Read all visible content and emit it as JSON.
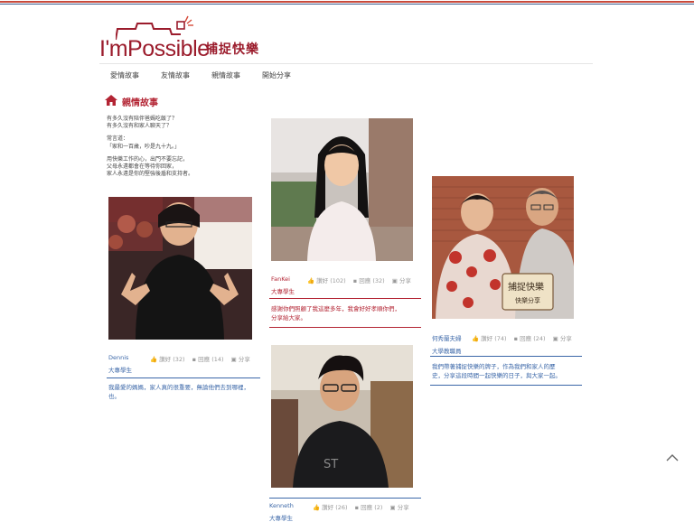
{
  "brand": {
    "logo_text": "I'mPossible",
    "logo_cn": "捕捉快樂",
    "brand_color": "#9b1c2c"
  },
  "nav": {
    "items": [
      "愛情故事",
      "友情故事",
      "親情故事",
      "開始分享"
    ]
  },
  "section": {
    "title": "親情故事",
    "icon": "home-icon",
    "accent": "#b32433"
  },
  "intro": {
    "lines1": [
      "有多久沒有陪伴爸媽吃飯了？",
      "有多久沒有和家人聊天了？"
    ],
    "lines2": [
      "常言道：",
      "「家和一百歲，吵是九十九。」"
    ],
    "lines3": [
      "用快樂工作的心，出門不要忘記，",
      "父母永遠都會在等待你回家，",
      "家人永遠是你的堅強後盾和支持者。"
    ]
  },
  "cards": [
    {
      "name": "Dennis",
      "role": "大專學生",
      "likes": "讚好 (32)",
      "comments": "回應 (14)",
      "share": "分享",
      "desc": [
        "我最愛的媽媽，家人真的很重要，無論他們去到哪裡，",
        "也。"
      ],
      "line_color": "#3b67a8"
    },
    {
      "name": "FanKei",
      "role": "大專學生",
      "likes": "讚好 (102)",
      "comments": "回應 (32)",
      "share": "分享",
      "desc": [
        "感謝你們照顧了我這麼多年，我會好好孝順你們，",
        "分享給大家。"
      ],
      "line_color": "#b32433"
    },
    {
      "name": "Kenneth",
      "role": "大專學生",
      "likes": "讚好 (26)",
      "comments": "回應 (2)",
      "share": "分享",
      "line_color": "#3b67a8"
    },
    {
      "name": "何秀蘭夫婦",
      "role": "大學教職員",
      "likes": "讚好 (74)",
      "comments": "回應 (24)",
      "share": "分享",
      "desc": [
        "我們帶著捕捉快樂的牌子，作為我們和家人的歷",
        "史，分享這段時間一起快樂的日子，與大家一起。"
      ],
      "line_color": "#3b67a8",
      "sign_line1": "捕捉快樂",
      "sign_line2": "快樂分享"
    }
  ]
}
